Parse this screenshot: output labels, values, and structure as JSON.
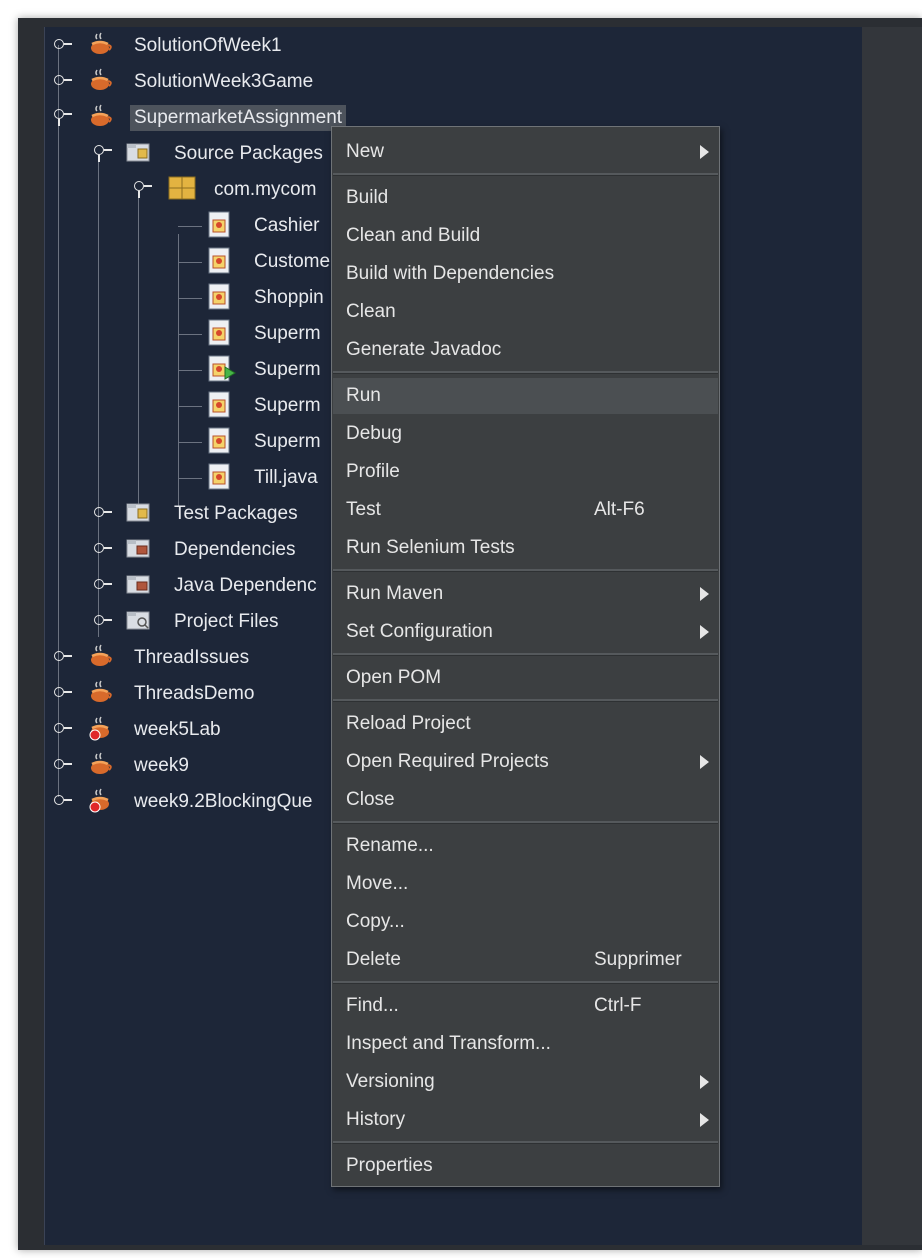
{
  "tree": {
    "items": [
      {
        "label": "SolutionOfWeek1",
        "icon": "maven-project-icon"
      },
      {
        "label": "SolutionWeek3Game",
        "icon": "maven-project-icon"
      },
      {
        "label": "SupermarketAssignment",
        "icon": "maven-project-icon"
      },
      {
        "label": "Source Packages",
        "icon": "source-packages-icon"
      },
      {
        "label": "com.mycom",
        "icon": "java-package-icon"
      },
      {
        "label": "Cashier",
        "icon": "java-file-icon"
      },
      {
        "label": "Custome",
        "icon": "java-file-icon"
      },
      {
        "label": "Shoppin",
        "icon": "java-file-icon"
      },
      {
        "label": "Superm",
        "icon": "java-file-icon"
      },
      {
        "label": "Superm",
        "icon": "java-main-class-icon"
      },
      {
        "label": "Superm",
        "icon": "java-file-icon"
      },
      {
        "label": "Superm",
        "icon": "java-file-icon"
      },
      {
        "label": "Till.java",
        "icon": "java-file-icon"
      },
      {
        "label": "Test Packages",
        "icon": "test-packages-icon"
      },
      {
        "label": "Dependencies",
        "icon": "dependencies-icon"
      },
      {
        "label": "Java Dependenc",
        "icon": "java-dependencies-icon"
      },
      {
        "label": "Project Files",
        "icon": "project-files-icon"
      },
      {
        "label": "ThreadIssues",
        "icon": "maven-project-icon"
      },
      {
        "label": "ThreadsDemo",
        "icon": "maven-project-icon"
      },
      {
        "label": "week5Lab",
        "icon": "maven-project-error-icon"
      },
      {
        "label": "week9",
        "icon": "maven-project-icon"
      },
      {
        "label": "week9.2BlockingQue",
        "icon": "maven-project-error-icon"
      }
    ]
  },
  "menu": {
    "items": [
      {
        "label": "New",
        "shortcut": "",
        "submenu": true
      },
      {
        "label": "Build",
        "shortcut": "",
        "submenu": false
      },
      {
        "label": "Clean and Build",
        "shortcut": "",
        "submenu": false
      },
      {
        "label": "Build with Dependencies",
        "shortcut": "",
        "submenu": false
      },
      {
        "label": "Clean",
        "shortcut": "",
        "submenu": false
      },
      {
        "label": "Generate Javadoc",
        "shortcut": "",
        "submenu": false
      },
      {
        "label": "Run",
        "shortcut": "",
        "submenu": false,
        "highlighted": true
      },
      {
        "label": "Debug",
        "shortcut": "",
        "submenu": false
      },
      {
        "label": "Profile",
        "shortcut": "",
        "submenu": false
      },
      {
        "label": "Test",
        "shortcut": "Alt-F6",
        "submenu": false
      },
      {
        "label": "Run Selenium Tests",
        "shortcut": "",
        "submenu": false
      },
      {
        "label": "Run Maven",
        "shortcut": "",
        "submenu": true
      },
      {
        "label": "Set Configuration",
        "shortcut": "",
        "submenu": true
      },
      {
        "label": "Open POM",
        "shortcut": "",
        "submenu": false
      },
      {
        "label": "Reload Project",
        "shortcut": "",
        "submenu": false
      },
      {
        "label": "Open Required Projects",
        "shortcut": "",
        "submenu": true
      },
      {
        "label": "Close",
        "shortcut": "",
        "submenu": false
      },
      {
        "label": "Rename...",
        "shortcut": "",
        "submenu": false
      },
      {
        "label": "Move...",
        "shortcut": "",
        "submenu": false
      },
      {
        "label": "Copy...",
        "shortcut": "",
        "submenu": false
      },
      {
        "label": "Delete",
        "shortcut": "Supprimer",
        "submenu": false
      },
      {
        "label": "Find...",
        "shortcut": "Ctrl-F",
        "submenu": false
      },
      {
        "label": "Inspect and Transform...",
        "shortcut": "",
        "submenu": false
      },
      {
        "label": "Versioning",
        "shortcut": "",
        "submenu": true
      },
      {
        "label": "History",
        "shortcut": "",
        "submenu": true
      },
      {
        "label": "Properties",
        "shortcut": "",
        "submenu": false
      }
    ]
  },
  "colors": {
    "tree_background": "#1d2638",
    "menu_background": "#3c3f41",
    "menu_highlight": "#4b4f52",
    "text": "#e6e6e6"
  }
}
